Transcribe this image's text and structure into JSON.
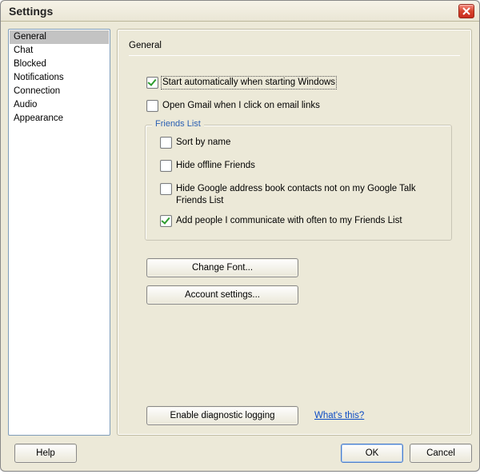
{
  "window": {
    "title": "Settings"
  },
  "sidebar": {
    "items": [
      {
        "label": "General",
        "selected": true
      },
      {
        "label": "Chat",
        "selected": false
      },
      {
        "label": "Blocked",
        "selected": false
      },
      {
        "label": "Notifications",
        "selected": false
      },
      {
        "label": "Connection",
        "selected": false
      },
      {
        "label": "Audio",
        "selected": false
      },
      {
        "label": "Appearance",
        "selected": false
      }
    ]
  },
  "panel": {
    "title": "General",
    "options": {
      "start_auto": {
        "label": "Start automatically when starting Windows",
        "checked": true,
        "focused": true
      },
      "open_gmail": {
        "label": "Open Gmail when I click on email links",
        "checked": false
      }
    },
    "friends_list": {
      "legend": "Friends List",
      "sort_by_name": {
        "label": "Sort by name",
        "checked": false
      },
      "hide_offline": {
        "label": "Hide offline Friends",
        "checked": false
      },
      "hide_addrbook": {
        "label": "Hide Google address book contacts not on my Google Talk Friends List",
        "checked": false
      },
      "add_often": {
        "label": "Add people I communicate with often to my Friends List",
        "checked": true
      }
    },
    "buttons": {
      "change_font": "Change Font...",
      "account_settings": "Account settings...",
      "diagnostic": "Enable diagnostic logging",
      "whats_this": "What's this?"
    }
  },
  "footer": {
    "help": "Help",
    "ok": "OK",
    "cancel": "Cancel"
  }
}
